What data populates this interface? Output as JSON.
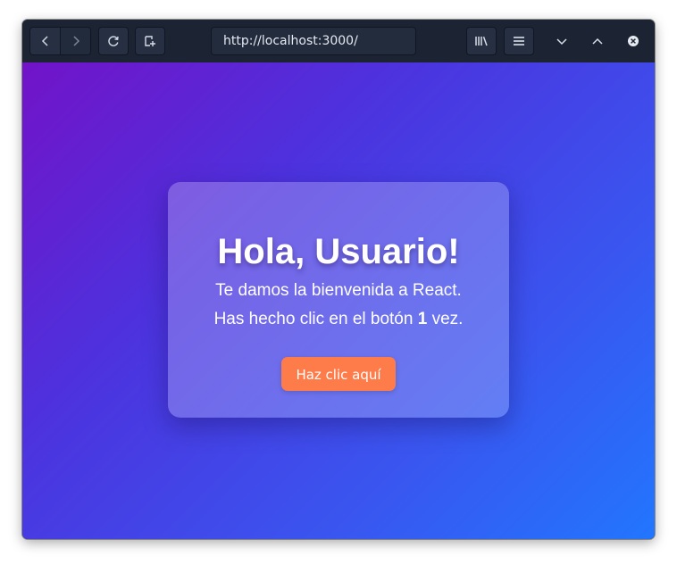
{
  "browser": {
    "url": "http://localhost:3000/"
  },
  "page": {
    "heading": "Hola, Usuario!",
    "welcome": "Te damos la bienvenida a React.",
    "clicks_prefix": "Has hecho clic en el botón ",
    "click_count": "1",
    "clicks_suffix": " vez.",
    "button_label": "Haz clic aquí"
  },
  "colors": {
    "toolbar_bg": "#1c2433",
    "gradient_start": "#7213c8",
    "gradient_end": "#2276fe",
    "button_bg": "#fd7c4a"
  },
  "icons": [
    "back-icon",
    "forward-icon",
    "reload-icon",
    "new-tab-icon",
    "library-icon",
    "menu-icon",
    "minimize-icon",
    "maximize-icon",
    "close-icon"
  ]
}
